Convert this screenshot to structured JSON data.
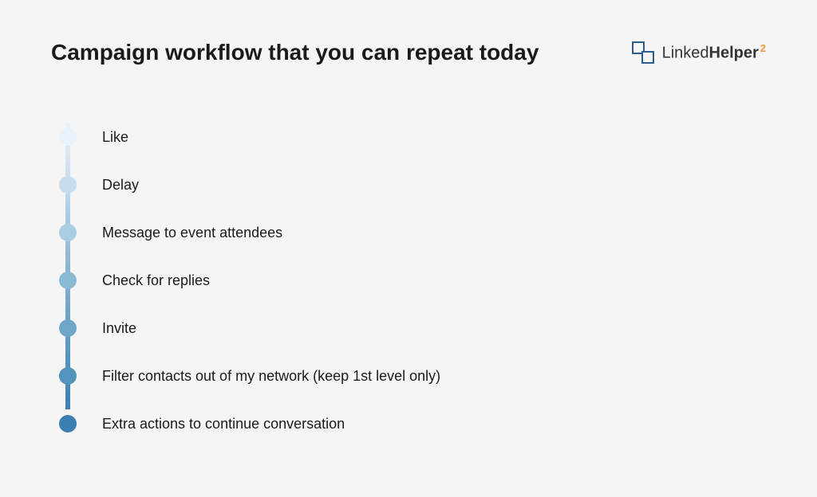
{
  "title": "Campaign workflow that you can repeat today",
  "logo": {
    "brand_part1": "Linked",
    "brand_part2": "Helper",
    "version": "2"
  },
  "workflow_steps": [
    {
      "label": "Like"
    },
    {
      "label": "Delay"
    },
    {
      "label": "Message to event attendees"
    },
    {
      "label": "Check for replies"
    },
    {
      "label": "Invite"
    },
    {
      "label": "Filter contacts out of my network (keep 1st level only)"
    },
    {
      "label": "Extra actions to continue conversation"
    }
  ]
}
